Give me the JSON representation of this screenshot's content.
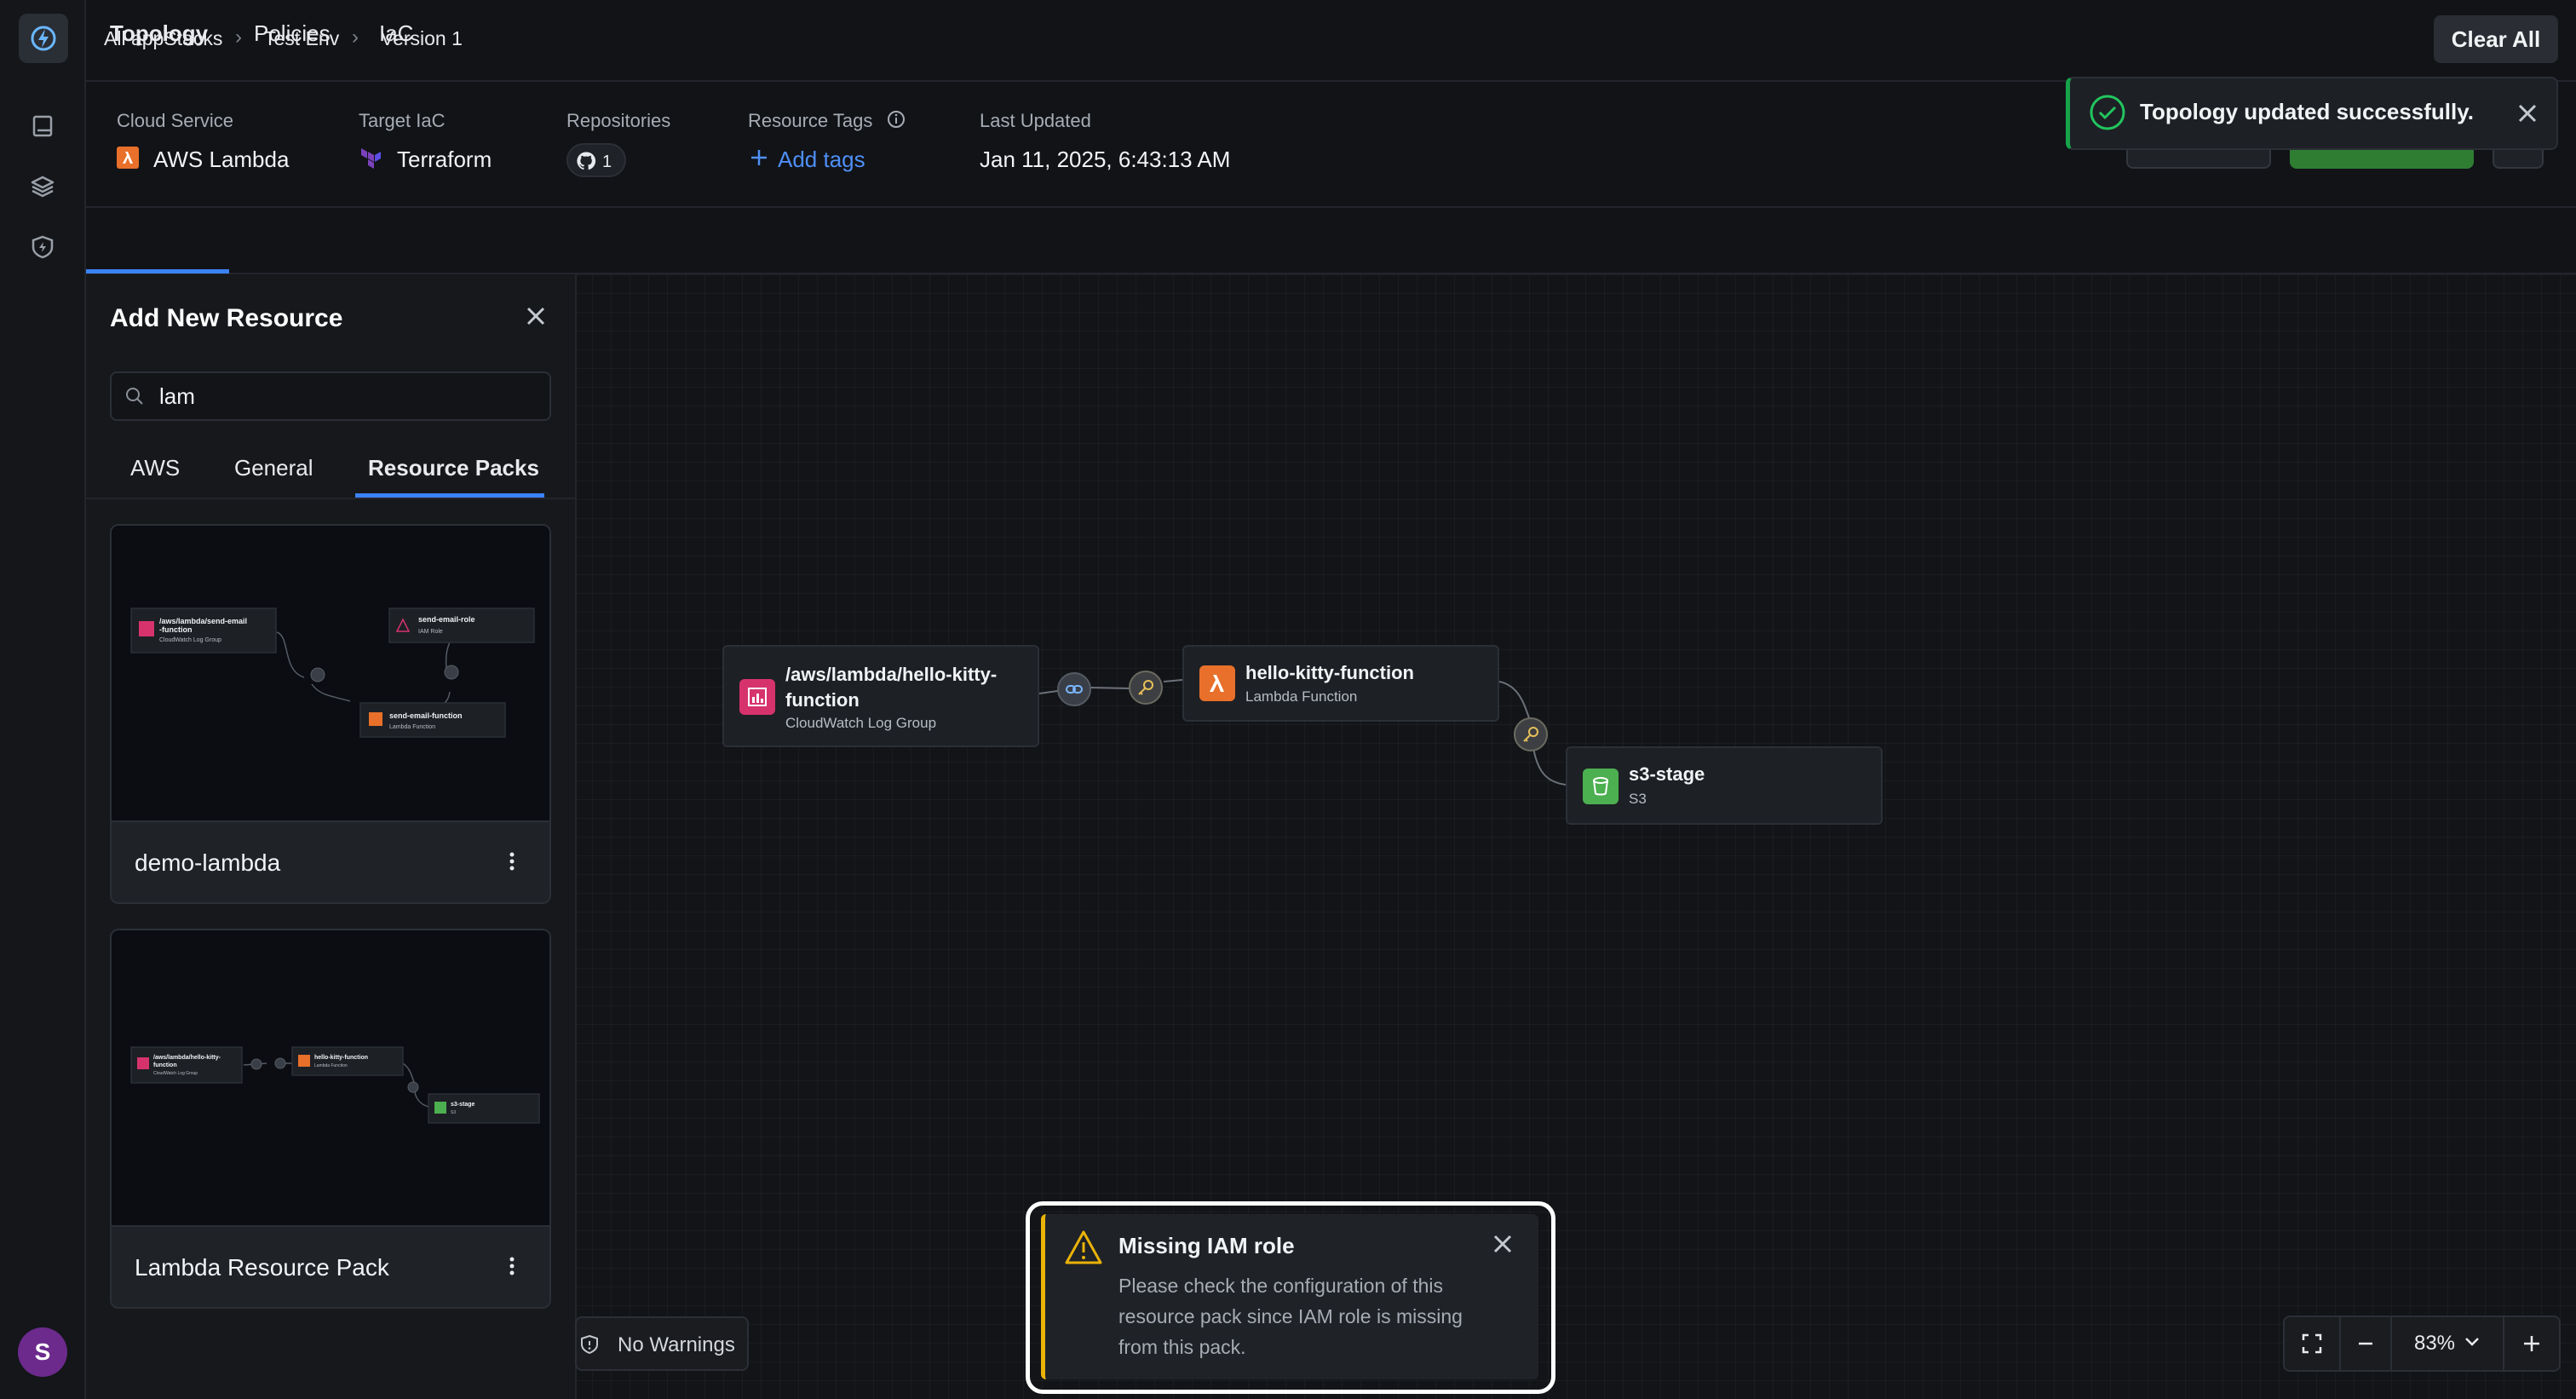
{
  "app": {
    "avatar_initial": "S"
  },
  "breadcrumb": [
    "All appStacks",
    "Test Env",
    "Version 1"
  ],
  "header": {
    "clear_all": "Clear All"
  },
  "info": {
    "cloud_service": {
      "label": "Cloud Service",
      "value": "AWS Lambda"
    },
    "target_iac": {
      "label": "Target IaC",
      "value": "Terraform"
    },
    "repositories": {
      "label": "Repositories",
      "count": "1"
    },
    "resource_tags": {
      "label": "Resource Tags",
      "add_label": "Add tags"
    },
    "last_updated": {
      "label": "Last Updated",
      "value": "Jan 11, 2025, 6:43:13 AM"
    }
  },
  "tabs": [
    "Topology",
    "Policies",
    "IaC"
  ],
  "panel": {
    "title": "Add New Resource",
    "search_value": "lam",
    "subtabs": [
      "AWS",
      "General",
      "Resource Packs"
    ],
    "packs": [
      {
        "name": "demo-lambda"
      },
      {
        "name": "Lambda Resource Pack"
      }
    ]
  },
  "preview1": {
    "n1_title": "/aws/lambda/send-email",
    "n1_title2": "-function",
    "n1_sub": "CloudWatch Log Group",
    "n2_title": "send-email-role",
    "n2_sub": "IAM Role",
    "n3_title": "send-email-function",
    "n3_sub": "Lambda Function"
  },
  "preview2": {
    "n1_title": "/aws/lambda/hello-kitty-",
    "n1_title2": "function",
    "n1_sub": "CloudWatch Log Group",
    "n2_title": "hello-kitty-function",
    "n2_sub": "Lambda Function",
    "n3_title": "s3-stage",
    "n3_sub": "S3"
  },
  "topology": {
    "nodes": [
      {
        "title_line1": "/aws/lambda/hello-kitty-",
        "title_line2": "function",
        "subtitle": "CloudWatch Log Group"
      },
      {
        "title": "hello-kitty-function",
        "subtitle": "Lambda Function"
      },
      {
        "title": "s3-stage",
        "subtitle": "S3"
      }
    ]
  },
  "toast": {
    "message": "Topology updated successfully."
  },
  "warning": {
    "title": "Missing IAM role",
    "body": "Please check the configuration of this resource pack since IAM role is missing from this pack."
  },
  "footer": {
    "warnings": "No Warnings",
    "zoom": "83%"
  },
  "colors": {
    "accent": "#3b82f6",
    "success": "#16a34a",
    "warning": "#eab308",
    "lambda": "#e8702a",
    "cloudwatch": "#d6336c",
    "s3": "#4caf50",
    "terraform": "#7b42bc",
    "avatar": "#6b2a8c"
  }
}
